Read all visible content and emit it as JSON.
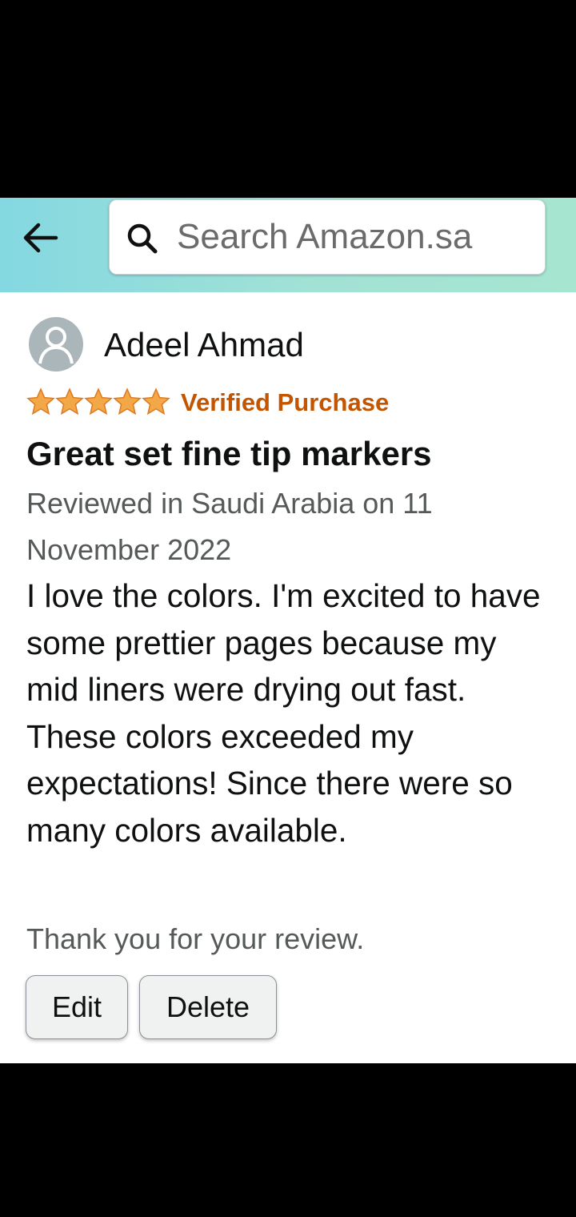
{
  "header": {
    "back_icon": "back-arrow-icon",
    "search_icon": "search-icon",
    "search_placeholder": "Search Amazon.sa",
    "gradient_colors": [
      "#84d8e1",
      "#a6e5d0"
    ]
  },
  "review": {
    "reviewer_name": "Adeel Ahmad",
    "avatar_icon": "user-avatar-icon",
    "rating": 5,
    "rating_max": 5,
    "star_icon": "star-icon",
    "star_color": "#f3a847",
    "verified_label": "Verified Purchase",
    "verified_color": "#c45500",
    "title": "Great set fine tip markers",
    "date_text": "Reviewed in Saudi Arabia on 11 November 2022",
    "body": "I love the colors. I'm excited to have some prettier pages because my mid liners were drying out fast. These colors exceeded my expectations! Since there were so many colors available.",
    "thanks_text": "Thank you for your review.",
    "edit_label": "Edit",
    "delete_label": "Delete"
  }
}
